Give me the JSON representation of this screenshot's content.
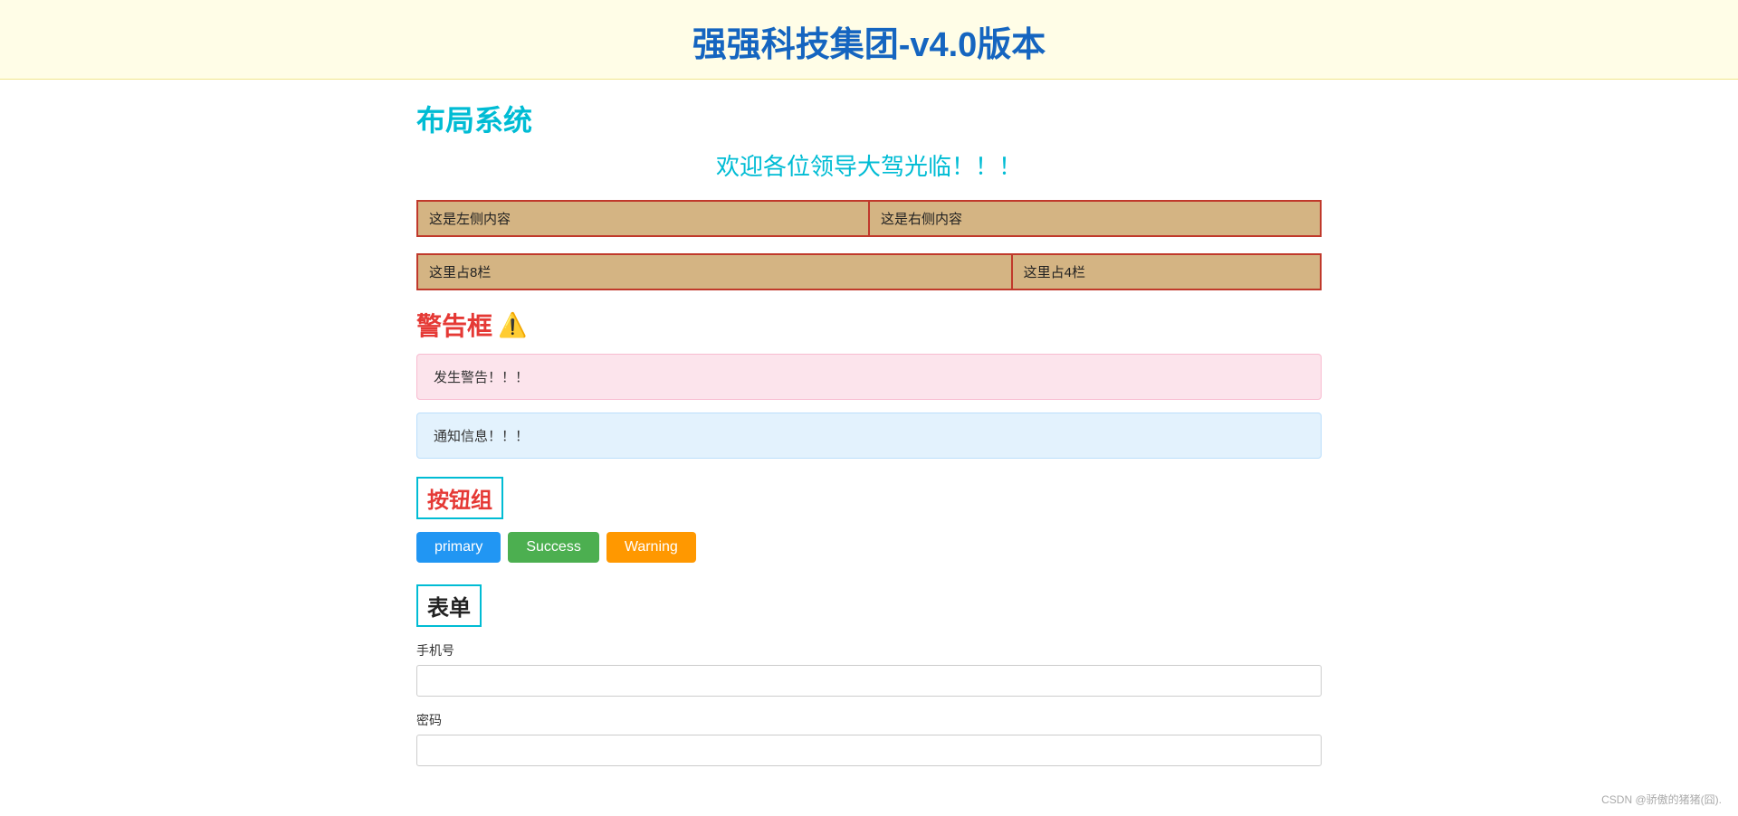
{
  "header": {
    "title": "强强科技集团-v4.0版本",
    "background": "#fffde7"
  },
  "layout": {
    "title": "布局系统",
    "welcome": "欢迎各位领导大驾光临！！！"
  },
  "grid": {
    "row1": {
      "left": "这是左侧内容",
      "right": "这是右侧内容"
    },
    "row2": {
      "col8": "这里占8栏",
      "col4": "这里占4栏"
    }
  },
  "warning_section": {
    "heading": "警告框",
    "icon": "⚠️",
    "alert_danger_text": "发生警告！！！",
    "alert_info_text": "通知信息！！！"
  },
  "button_group": {
    "heading": "按钮组",
    "buttons": [
      {
        "label": "primary",
        "type": "primary"
      },
      {
        "label": "Success",
        "type": "success"
      },
      {
        "label": "Warning",
        "type": "warning"
      }
    ]
  },
  "form": {
    "heading": "表单",
    "fields": [
      {
        "label": "手机号",
        "placeholder": "",
        "type": "text"
      },
      {
        "label": "密码",
        "placeholder": "",
        "type": "password"
      }
    ]
  },
  "watermark": "CSDN @骄傲的猪猪(囧)."
}
